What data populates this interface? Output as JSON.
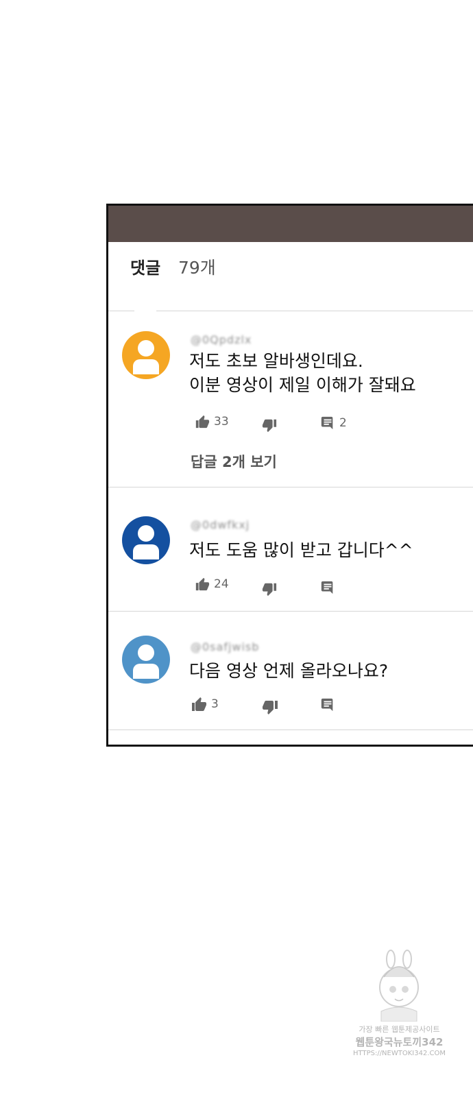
{
  "header": {
    "title": "댓글",
    "count": "79개"
  },
  "comments": [
    {
      "username": "@0Qpdzlx",
      "avatar_color": "#f5a623",
      "lines": [
        "저도 초보 알바생인데요.",
        "이분 영상이 제일 이해가 잘돼요"
      ],
      "likes": "33",
      "reply_count": "2",
      "view_replies": "답글 2개 보기"
    },
    {
      "username": "@0dwfkxj",
      "avatar_color": "#1450a0",
      "lines": [
        "저도 도움 많이 받고 갑니다^^"
      ],
      "likes": "24"
    },
    {
      "username": "@0safjwisb",
      "avatar_color": "#4f93c8",
      "lines": [
        "다음 영상 언제 올라오나요?"
      ],
      "likes": "3"
    }
  ],
  "watermark": {
    "line1": "가장 빠른 웹툰제공사이트",
    "line2": "웹툰왕국뉴토끼342",
    "line3": "HTTPS://NEWTOKI342.COM"
  },
  "icons": [
    "thumb-up-icon",
    "thumb-down-icon",
    "reply-icon",
    "avatar-icon"
  ]
}
